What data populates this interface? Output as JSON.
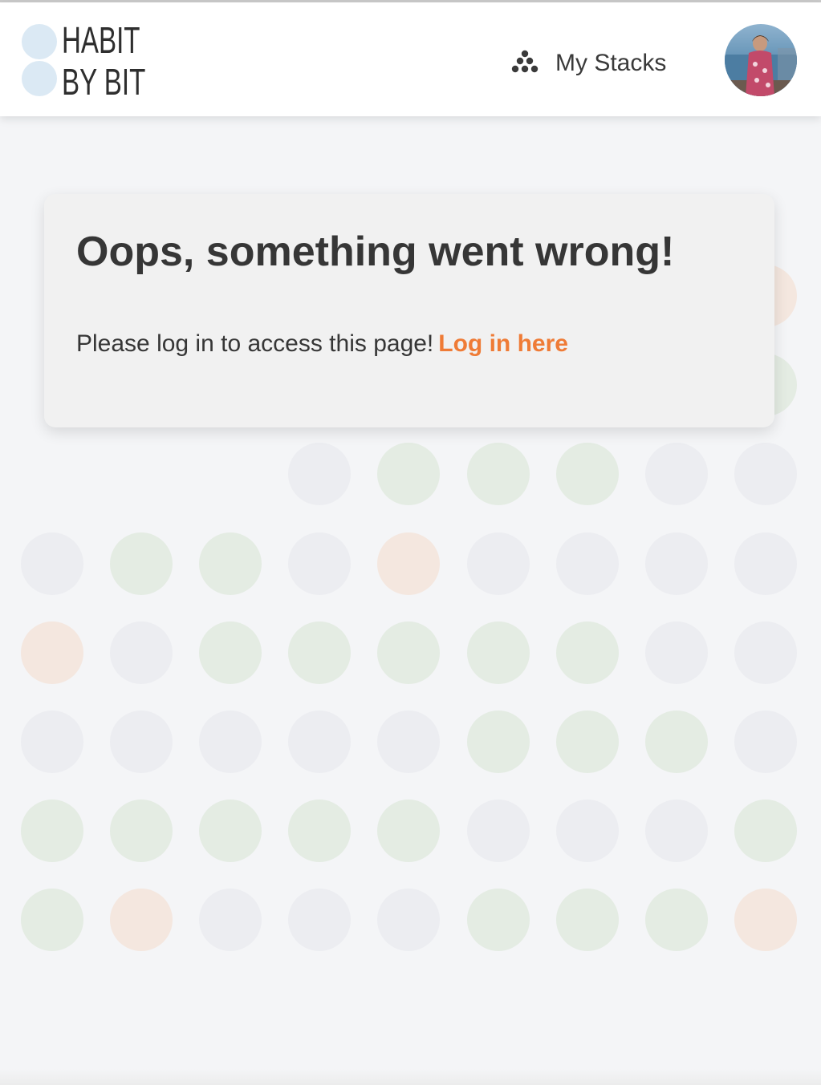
{
  "brand": {
    "line1": "HABIT",
    "line2": "BY BIT",
    "dot_color": "#dbe9f4"
  },
  "nav": {
    "stacks_label": "My Stacks",
    "stacks_icon": "stack-icon"
  },
  "user": {
    "avatar_icon": "user-avatar"
  },
  "error": {
    "title": "Oops, something went wrong!",
    "message": "Please log in to access this page!",
    "link_label": "Log in here"
  },
  "colors": {
    "link": "#ef7b36",
    "background": "#f4f5f7",
    "card": "#f1f1f1",
    "dot_grey": "#ecedf1",
    "dot_green": "#e4ece3",
    "dot_orange": "#f4e7df"
  },
  "habit_grid": {
    "legend": {
      "g": "gray",
      "n": "green",
      "o": "orange",
      "_": "empty"
    },
    "rows": [
      "________o",
      "_____gggn",
      "___gnnngg",
      "gnngogggg",
      "ognnnnngg",
      "gggggnnng",
      "nnnnngggn",
      "nogggnnno"
    ]
  }
}
